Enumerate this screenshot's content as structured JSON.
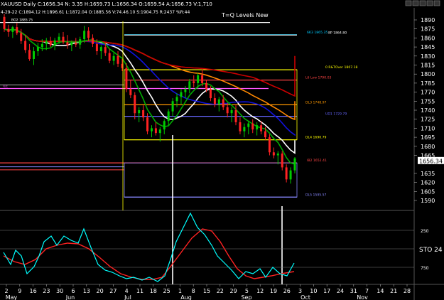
{
  "header": {
    "line1": "XAUUSD Daily  C:1656.34  N:  3.35  H:1659.73  L:1656.34  O:1659.54  A:1656.73  V:1,710",
    "line2": "4-29-22  C:1894.12  H:1896.61  L:1872.04  O:1885.56  V:74.46.10  S:1904.75  R:2437  %R:44",
    "title": "T=Q Levels New"
  },
  "chart_data": {
    "type": "candlestick",
    "symbol": "XAUUSD",
    "timeframe": "Daily",
    "last_price": "1656.34",
    "y_ticks": [
      1890,
      1875,
      1860,
      1845,
      1830,
      1815,
      1800,
      1785,
      1770,
      1755,
      1740,
      1725,
      1710,
      1695,
      1680,
      1665,
      1635,
      1620,
      1605,
      1590
    ],
    "x_ticks": [
      "2",
      "9",
      "16",
      "23",
      "30",
      "6",
      "13",
      "20",
      "27",
      "4",
      "11",
      "18",
      "25",
      "1",
      "8",
      "15",
      "22",
      "29",
      "5",
      "12",
      "19",
      "26",
      "3",
      "10",
      "17",
      "24",
      "31",
      "7",
      "14",
      "21",
      "28"
    ],
    "x_months": [
      "May",
      "Jun",
      "Jul",
      "Aug",
      "Sep",
      "Oct",
      "Nov"
    ],
    "levels": [
      {
        "label": "BO2 1885.75",
        "price": 1885.75,
        "color": "#ffffff"
      },
      {
        "label": "6K3 1865.35",
        "price": 1865.4,
        "color": "#00ccff"
      },
      {
        "label": "8P 1864.80",
        "price": 1864.8,
        "color": "#ffffff"
      },
      {
        "label": "0 R&TOver 1807.18",
        "price": 1807.18,
        "color": "#ffff00"
      },
      {
        "label": "L6 Low 1790.03",
        "price": 1790.03,
        "color": "#ff4444"
      },
      {
        "label": "I1E",
        "price": 1776,
        "color": "#ff55ff"
      },
      {
        "label": "DL3 1748.97",
        "price": 1748.97,
        "color": "#ff9900"
      },
      {
        "label": "UD1 1729.79",
        "price": 1729.79,
        "color": "#6666ff"
      },
      {
        "label": "DL4 1690.79",
        "price": 1690.79,
        "color": "#ffff00"
      },
      {
        "label": "IB2 1652.41",
        "price": 1652.41,
        "color": "#ff4444"
      },
      {
        "label": "DL5 1595.57",
        "price": 1595.57,
        "color": "#8888ff"
      }
    ],
    "candles": [
      {
        "o": 1895,
        "h": 1900,
        "l": 1870,
        "c": 1875
      },
      {
        "o": 1875,
        "h": 1882,
        "l": 1862,
        "c": 1870
      },
      {
        "o": 1870,
        "h": 1880,
        "l": 1860,
        "c": 1878
      },
      {
        "o": 1878,
        "h": 1885,
        "l": 1865,
        "c": 1868
      },
      {
        "o": 1868,
        "h": 1875,
        "l": 1850,
        "c": 1855
      },
      {
        "o": 1855,
        "h": 1865,
        "l": 1835,
        "c": 1840
      },
      {
        "o": 1840,
        "h": 1850,
        "l": 1822,
        "c": 1825
      },
      {
        "o": 1825,
        "h": 1845,
        "l": 1815,
        "c": 1838
      },
      {
        "o": 1838,
        "h": 1852,
        "l": 1830,
        "c": 1845
      },
      {
        "o": 1845,
        "h": 1858,
        "l": 1838,
        "c": 1850
      },
      {
        "o": 1850,
        "h": 1860,
        "l": 1840,
        "c": 1855
      },
      {
        "o": 1855,
        "h": 1862,
        "l": 1845,
        "c": 1848
      },
      {
        "o": 1848,
        "h": 1860,
        "l": 1840,
        "c": 1856
      },
      {
        "o": 1856,
        "h": 1868,
        "l": 1850,
        "c": 1862
      },
      {
        "o": 1862,
        "h": 1870,
        "l": 1850,
        "c": 1853
      },
      {
        "o": 1853,
        "h": 1865,
        "l": 1842,
        "c": 1848
      },
      {
        "o": 1848,
        "h": 1856,
        "l": 1838,
        "c": 1852
      },
      {
        "o": 1852,
        "h": 1860,
        "l": 1845,
        "c": 1849
      },
      {
        "o": 1849,
        "h": 1862,
        "l": 1842,
        "c": 1858
      },
      {
        "o": 1858,
        "h": 1880,
        "l": 1852,
        "c": 1872
      },
      {
        "o": 1872,
        "h": 1878,
        "l": 1855,
        "c": 1860
      },
      {
        "o": 1860,
        "h": 1866,
        "l": 1845,
        "c": 1850
      },
      {
        "o": 1850,
        "h": 1858,
        "l": 1832,
        "c": 1838
      },
      {
        "o": 1838,
        "h": 1848,
        "l": 1825,
        "c": 1845
      },
      {
        "o": 1845,
        "h": 1852,
        "l": 1830,
        "c": 1835
      },
      {
        "o": 1835,
        "h": 1842,
        "l": 1818,
        "c": 1822
      },
      {
        "o": 1822,
        "h": 1835,
        "l": 1815,
        "c": 1830
      },
      {
        "o": 1830,
        "h": 1838,
        "l": 1812,
        "c": 1817
      },
      {
        "o": 1817,
        "h": 1825,
        "l": 1805,
        "c": 1810
      },
      {
        "o": 1810,
        "h": 1818,
        "l": 1770,
        "c": 1775
      },
      {
        "o": 1775,
        "h": 1790,
        "l": 1760,
        "c": 1765
      },
      {
        "o": 1765,
        "h": 1770,
        "l": 1725,
        "c": 1735
      },
      {
        "o": 1735,
        "h": 1745,
        "l": 1720,
        "c": 1740
      },
      {
        "o": 1740,
        "h": 1748,
        "l": 1722,
        "c": 1728
      },
      {
        "o": 1728,
        "h": 1735,
        "l": 1700,
        "c": 1705
      },
      {
        "o": 1705,
        "h": 1715,
        "l": 1695,
        "c": 1710
      },
      {
        "o": 1710,
        "h": 1720,
        "l": 1698,
        "c": 1702
      },
      {
        "o": 1702,
        "h": 1712,
        "l": 1688,
        "c": 1708
      },
      {
        "o": 1708,
        "h": 1725,
        "l": 1700,
        "c": 1722
      },
      {
        "o": 1722,
        "h": 1742,
        "l": 1715,
        "c": 1738
      },
      {
        "o": 1738,
        "h": 1760,
        "l": 1730,
        "c": 1755
      },
      {
        "o": 1755,
        "h": 1768,
        "l": 1745,
        "c": 1762
      },
      {
        "o": 1762,
        "h": 1775,
        "l": 1750,
        "c": 1770
      },
      {
        "o": 1770,
        "h": 1780,
        "l": 1760,
        "c": 1775
      },
      {
        "o": 1775,
        "h": 1792,
        "l": 1768,
        "c": 1788
      },
      {
        "o": 1788,
        "h": 1798,
        "l": 1778,
        "c": 1785
      },
      {
        "o": 1785,
        "h": 1802,
        "l": 1775,
        "c": 1798
      },
      {
        "o": 1798,
        "h": 1808,
        "l": 1780,
        "c": 1785
      },
      {
        "o": 1785,
        "h": 1790,
        "l": 1770,
        "c": 1775
      },
      {
        "o": 1775,
        "h": 1780,
        "l": 1755,
        "c": 1760
      },
      {
        "o": 1760,
        "h": 1768,
        "l": 1745,
        "c": 1750
      },
      {
        "o": 1750,
        "h": 1762,
        "l": 1738,
        "c": 1758
      },
      {
        "o": 1758,
        "h": 1765,
        "l": 1740,
        "c": 1745
      },
      {
        "o": 1745,
        "h": 1752,
        "l": 1728,
        "c": 1735
      },
      {
        "o": 1735,
        "h": 1745,
        "l": 1720,
        "c": 1740
      },
      {
        "o": 1740,
        "h": 1748,
        "l": 1715,
        "c": 1720
      },
      {
        "o": 1720,
        "h": 1728,
        "l": 1700,
        "c": 1705
      },
      {
        "o": 1705,
        "h": 1718,
        "l": 1695,
        "c": 1712
      },
      {
        "o": 1712,
        "h": 1722,
        "l": 1700,
        "c": 1718
      },
      {
        "o": 1718,
        "h": 1725,
        "l": 1702,
        "c": 1708
      },
      {
        "o": 1708,
        "h": 1720,
        "l": 1698,
        "c": 1715
      },
      {
        "o": 1715,
        "h": 1722,
        "l": 1700,
        "c": 1705
      },
      {
        "o": 1705,
        "h": 1712,
        "l": 1690,
        "c": 1695
      },
      {
        "o": 1695,
        "h": 1700,
        "l": 1665,
        "c": 1670
      },
      {
        "o": 1670,
        "h": 1678,
        "l": 1660,
        "c": 1665
      },
      {
        "o": 1665,
        "h": 1672,
        "l": 1650,
        "c": 1668
      },
      {
        "o": 1668,
        "h": 1672,
        "l": 1640,
        "c": 1645
      },
      {
        "o": 1645,
        "h": 1650,
        "l": 1620,
        "c": 1625
      },
      {
        "o": 1625,
        "h": 1645,
        "l": 1618,
        "c": 1640
      },
      {
        "o": 1640,
        "h": 1662,
        "l": 1635,
        "c": 1660
      }
    ],
    "stochastic": {
      "label": "STO 24",
      "k_color": "#00ffff",
      "d_color": "#ff2222",
      "levels": [
        "250",
        "750"
      ]
    },
    "colors": {
      "up_candle": "#00cc00",
      "down_candle": "#ff2222",
      "ma_white": "#ffffff",
      "ma_blue": "#1111dd",
      "ma_orange": "#ff8800",
      "ma_red": "#cc0000",
      "ma_green": "#00aa00",
      "ma_yellow": "#ffcc33",
      "last_price_tag": "#ffffff"
    }
  }
}
